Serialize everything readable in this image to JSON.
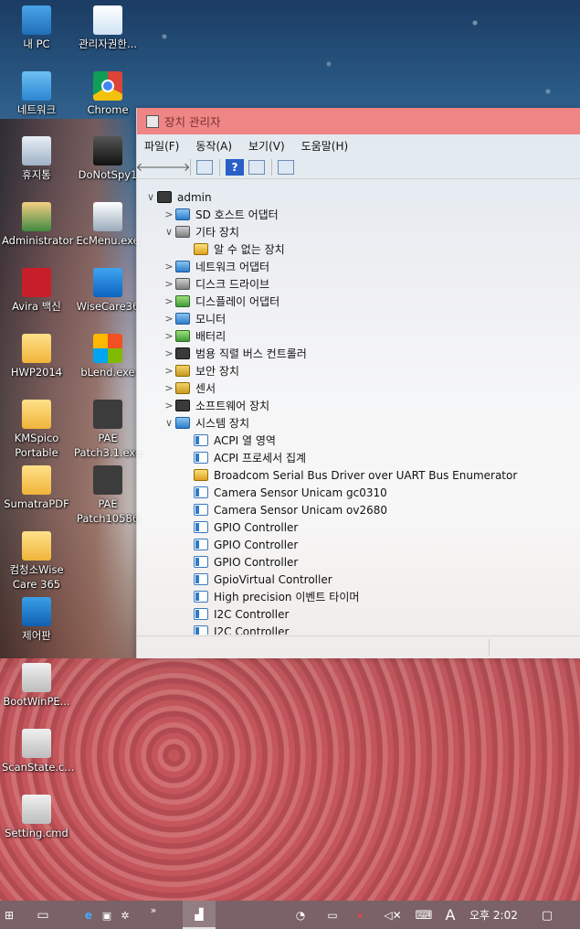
{
  "desktop": {
    "icons": [
      {
        "label": "내 PC",
        "icon": "pc-icon"
      },
      {
        "label": "관리자권한...",
        "icon": "document-icon"
      },
      {
        "label": "네트워크",
        "icon": "network-icon"
      },
      {
        "label": "Chrome",
        "icon": "chrome-icon"
      },
      {
        "label": "휴지통",
        "icon": "recycle-bin-icon"
      },
      {
        "label": "DoNotSpy1",
        "icon": "binoculars-icon"
      },
      {
        "label": "Administrator",
        "icon": "user-folder-icon"
      },
      {
        "label": "EcMenu.exe",
        "icon": "ecmenu-icon"
      },
      {
        "label": "Avira 백신",
        "icon": "avira-icon"
      },
      {
        "label": "WiseCare36",
        "icon": "wisecare-icon"
      },
      {
        "label": "HWP2014",
        "icon": "folder-icon"
      },
      {
        "label": "bLend.exe",
        "icon": "windows-icon"
      },
      {
        "label": "KMSpico\nPortable",
        "icon": "folder-icon"
      },
      {
        "label": "PAE\nPatch3.1.exe",
        "icon": "box-icon"
      },
      {
        "label": "SumatraPDF",
        "icon": "folder-icon"
      },
      {
        "label": "PAE\nPatch10586",
        "icon": "box-icon"
      },
      {
        "label": "컴청소Wise\nCare 365",
        "icon": "folder-icon"
      },
      {
        "label": "제어판",
        "icon": "control-panel-icon"
      },
      {
        "label": "BootWinPE...",
        "icon": "cmd-script-icon"
      },
      {
        "label": "ScanState.c...",
        "icon": "cmd-script-icon"
      },
      {
        "label": "Setting.cmd",
        "icon": "cmd-script-icon"
      }
    ]
  },
  "window": {
    "title": "장치 관리자",
    "menu": [
      "파일(F)",
      "동작(A)",
      "보기(V)",
      "도움말(H)"
    ],
    "toolbar_help": "?",
    "tree": [
      {
        "label": "admin",
        "chev": "∨",
        "level": 0,
        "icon": "computer-icon",
        "cls": "dark"
      },
      {
        "label": "SD 호스트 어댑터",
        "chev": ">",
        "level": 1,
        "icon": "sd-host-icon",
        "cls": "blue"
      },
      {
        "label": "기타 장치",
        "chev": "∨",
        "level": 1,
        "icon": "other-devices-icon",
        "cls": "grey"
      },
      {
        "label": "알 수 없는 장치",
        "chev": "",
        "level": 2,
        "icon": "unknown-device-warning-icon",
        "cls": "warn"
      },
      {
        "label": "네트워크 어댑터",
        "chev": ">",
        "level": 1,
        "icon": "network-adapter-icon",
        "cls": "blue"
      },
      {
        "label": "디스크 드라이브",
        "chev": ">",
        "level": 1,
        "icon": "disk-drive-icon",
        "cls": "grey"
      },
      {
        "label": "디스플레이 어댑터",
        "chev": ">",
        "level": 1,
        "icon": "display-adapter-icon",
        "cls": "green"
      },
      {
        "label": "모니터",
        "chev": ">",
        "level": 1,
        "icon": "monitor-icon",
        "cls": "blue"
      },
      {
        "label": "배터리",
        "chev": ">",
        "level": 1,
        "icon": "battery-icon",
        "cls": "green"
      },
      {
        "label": "범용 직렬 버스 컨트롤러",
        "chev": ">",
        "level": 1,
        "icon": "usb-icon",
        "cls": "dark"
      },
      {
        "label": "보안 장치",
        "chev": ">",
        "level": 1,
        "icon": "security-device-icon",
        "cls": "yellow"
      },
      {
        "label": "센서",
        "chev": ">",
        "level": 1,
        "icon": "sensor-icon",
        "cls": "yellow"
      },
      {
        "label": "소프트웨어 장치",
        "chev": ">",
        "level": 1,
        "icon": "software-device-icon",
        "cls": "dark"
      },
      {
        "label": "시스템 장치",
        "chev": "∨",
        "level": 1,
        "icon": "system-devices-icon",
        "cls": "blue"
      },
      {
        "label": "ACPI 열 영역",
        "chev": "",
        "level": 2,
        "icon": "device-icon",
        "cls": "dev"
      },
      {
        "label": "ACPI 프로세서 집계",
        "chev": "",
        "level": 2,
        "icon": "device-icon",
        "cls": "dev"
      },
      {
        "label": "Broadcom Serial Bus Driver over UART Bus Enumerator",
        "chev": "",
        "level": 2,
        "icon": "device-warning-icon",
        "cls": "warn"
      },
      {
        "label": "Camera Sensor Unicam gc0310",
        "chev": "",
        "level": 2,
        "icon": "device-icon",
        "cls": "dev"
      },
      {
        "label": "Camera Sensor Unicam ov2680",
        "chev": "",
        "level": 2,
        "icon": "device-icon",
        "cls": "dev"
      },
      {
        "label": "GPIO Controller",
        "chev": "",
        "level": 2,
        "icon": "device-icon",
        "cls": "dev"
      },
      {
        "label": "GPIO Controller",
        "chev": "",
        "level": 2,
        "icon": "device-icon",
        "cls": "dev"
      },
      {
        "label": "GPIO Controller",
        "chev": "",
        "level": 2,
        "icon": "device-icon",
        "cls": "dev"
      },
      {
        "label": "GpioVirtual Controller",
        "chev": "",
        "level": 2,
        "icon": "device-icon",
        "cls": "dev"
      },
      {
        "label": "High precision 이벤트 타이머",
        "chev": "",
        "level": 2,
        "icon": "device-icon",
        "cls": "dev"
      },
      {
        "label": "I2C Controller",
        "chev": "",
        "level": 2,
        "icon": "device-icon",
        "cls": "dev"
      },
      {
        "label": "I2C Controller",
        "chev": "",
        "level": 2,
        "icon": "device-icon",
        "cls": "dev"
      }
    ]
  },
  "taskbar": {
    "clock": "오후 2:02",
    "ime": "A",
    "more": "»"
  },
  "colors": {
    "titlebar": "#ef8585",
    "accent": "#2c7ccc"
  }
}
